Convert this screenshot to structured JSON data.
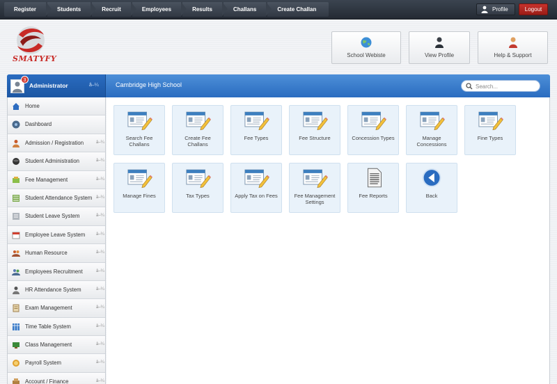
{
  "nav": {
    "crumbs": [
      "Register",
      "Students",
      "Recruit",
      "Employees",
      "Results",
      "Challans",
      "Create Challan"
    ],
    "profile": "Profile",
    "logout": "Logout"
  },
  "logo": {
    "text": "SMATYFY"
  },
  "header_buttons": {
    "website": "School Webiste",
    "view_profile": "View Profile",
    "help": "Help & Support"
  },
  "admin": {
    "name": "Administrator",
    "badge": "3",
    "caret": "â–¼"
  },
  "school": {
    "name": "Cambridge High School"
  },
  "search": {
    "placeholder": "Search..."
  },
  "sidebar": {
    "items": [
      {
        "label": "Home",
        "icon": "home-icon",
        "caret": ""
      },
      {
        "label": "Dashboard",
        "icon": "dashboard-icon",
        "caret": ""
      },
      {
        "label": "Admission / Registration",
        "icon": "admission-icon",
        "caret": "â–¼"
      },
      {
        "label": "Student Administration",
        "icon": "student-admin-icon",
        "caret": "â–¼"
      },
      {
        "label": "Fee Management",
        "icon": "fee-icon",
        "caret": "â–¼"
      },
      {
        "label": "Student Attendance System",
        "icon": "attendance-icon",
        "caret": "â–¼"
      },
      {
        "label": "Student Leave System",
        "icon": "leave-icon",
        "caret": "â–¼"
      },
      {
        "label": "Employee Leave System",
        "icon": "calendar-icon",
        "caret": "â–¼"
      },
      {
        "label": "Human Resource",
        "icon": "hr-icon",
        "caret": "â–¼"
      },
      {
        "label": "Employees Recruitment",
        "icon": "recruitment-icon",
        "caret": "â–¼"
      },
      {
        "label": "HR Attendance System",
        "icon": "hr-attendance-icon",
        "caret": "â–¼"
      },
      {
        "label": "Exam Management",
        "icon": "exam-icon",
        "caret": "â–¼"
      },
      {
        "label": "Time Table System",
        "icon": "timetable-icon",
        "caret": "â–¼"
      },
      {
        "label": "Class Management",
        "icon": "class-icon",
        "caret": "â–¼"
      },
      {
        "label": "Payroll System",
        "icon": "payroll-icon",
        "caret": "â–¼"
      },
      {
        "label": "Account / Finance",
        "icon": "finance-icon",
        "caret": "â–¼"
      }
    ]
  },
  "tiles": [
    {
      "label": "Search Fee Challans",
      "icon": "form-edit-icon"
    },
    {
      "label": "Create Fee Challans",
      "icon": "form-edit-icon"
    },
    {
      "label": "Fee Types",
      "icon": "form-edit-icon"
    },
    {
      "label": "Fee Structure",
      "icon": "form-edit-icon"
    },
    {
      "label": "Concession Types",
      "icon": "form-edit-icon"
    },
    {
      "label": "Manage Concessions",
      "icon": "form-edit-icon"
    },
    {
      "label": "Fine Types",
      "icon": "form-edit-icon"
    },
    {
      "label": "Manage Fines",
      "icon": "form-edit-icon"
    },
    {
      "label": "Tax Types",
      "icon": "form-edit-icon"
    },
    {
      "label": "Apply Tax on Fees",
      "icon": "form-edit-icon"
    },
    {
      "label": "Fee Management Settings",
      "icon": "form-edit-icon"
    },
    {
      "label": "Fee Reports",
      "icon": "document-icon"
    },
    {
      "label": "Back",
      "icon": "back-arrow-icon"
    }
  ]
}
